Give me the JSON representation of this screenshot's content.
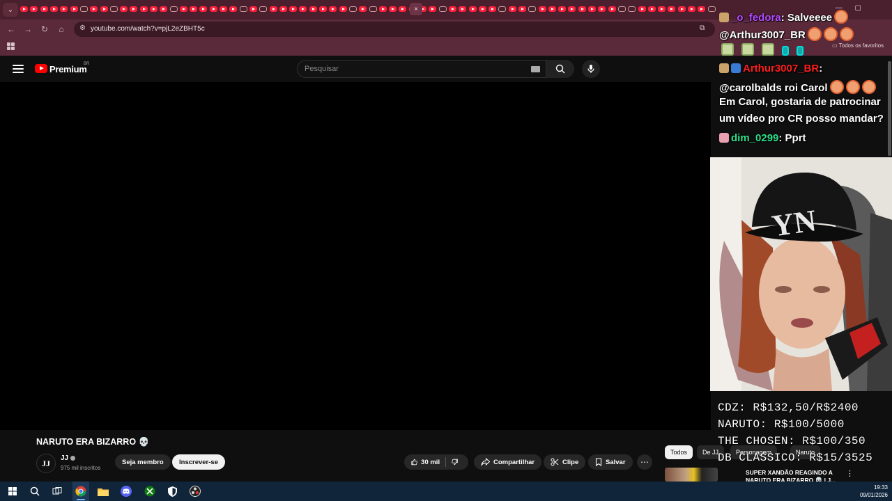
{
  "browser": {
    "url": "youtube.com/watch?v=pjL2eZBHT5c",
    "bookmarks_folder": "Todos os favoritos",
    "close_tab_symbol": "×"
  },
  "youtube": {
    "brand": "Premium",
    "region": "BR",
    "search_placeholder": "Pesquisar",
    "video_title": "NARUTO ERA BIZARRO 💀",
    "channel": {
      "avatar_text": "JJ",
      "name": "JJ",
      "subscribers": "975 mil inscritos"
    },
    "buttons": {
      "member": "Seja membro",
      "subscribe": "Inscrever-se",
      "likes": "30 mil",
      "share": "Compartilhar",
      "clip": "Clipe",
      "save": "Salvar"
    },
    "chips": [
      "Todos",
      "De JJ",
      "Personagem",
      "Naruto"
    ],
    "recommendation": {
      "title": "SUPER XANDÃO REAGINDO A NARUTO ERA BIZARRO 💀 | J..."
    }
  },
  "stream_chat": {
    "messages": [
      {
        "user": "_o_fedora",
        "text": ": Salveeee",
        "user_color": "#b64bff"
      },
      {
        "user": "",
        "text": "@Arthur3007_BR",
        "user_color": "#ffffff"
      },
      {
        "user": "Arthur3007_BR",
        "text": ":",
        "user_color": "#ff1e1e"
      },
      {
        "user": "",
        "text": "@carolbalds roi Carol",
        "user_color": "#ffffff"
      },
      {
        "user": "",
        "text": "Em Carol, gostaria de patrocinar",
        "user_color": "#ffffff"
      },
      {
        "user": "",
        "text": "um vídeo pro CR posso mandar?",
        "user_color": "#ffffff"
      },
      {
        "user": "dim_0299",
        "text": ": Pprt",
        "user_color": "#2de08a"
      }
    ]
  },
  "donation_goals": [
    "CDZ: R$132,50/R$2400",
    "NARUTO: R$100/5000",
    "THE CHOSEN: R$100/350",
    "DB CLASSICO: R$15/3525"
  ],
  "taskbar": {
    "time": "19:33",
    "date": "09/01/2026"
  },
  "colors": {
    "browser_frame": "#5a2a3a",
    "youtube_red": "#ff0000",
    "page_bg": "#0f0f0f",
    "taskbar": "#10243a"
  }
}
